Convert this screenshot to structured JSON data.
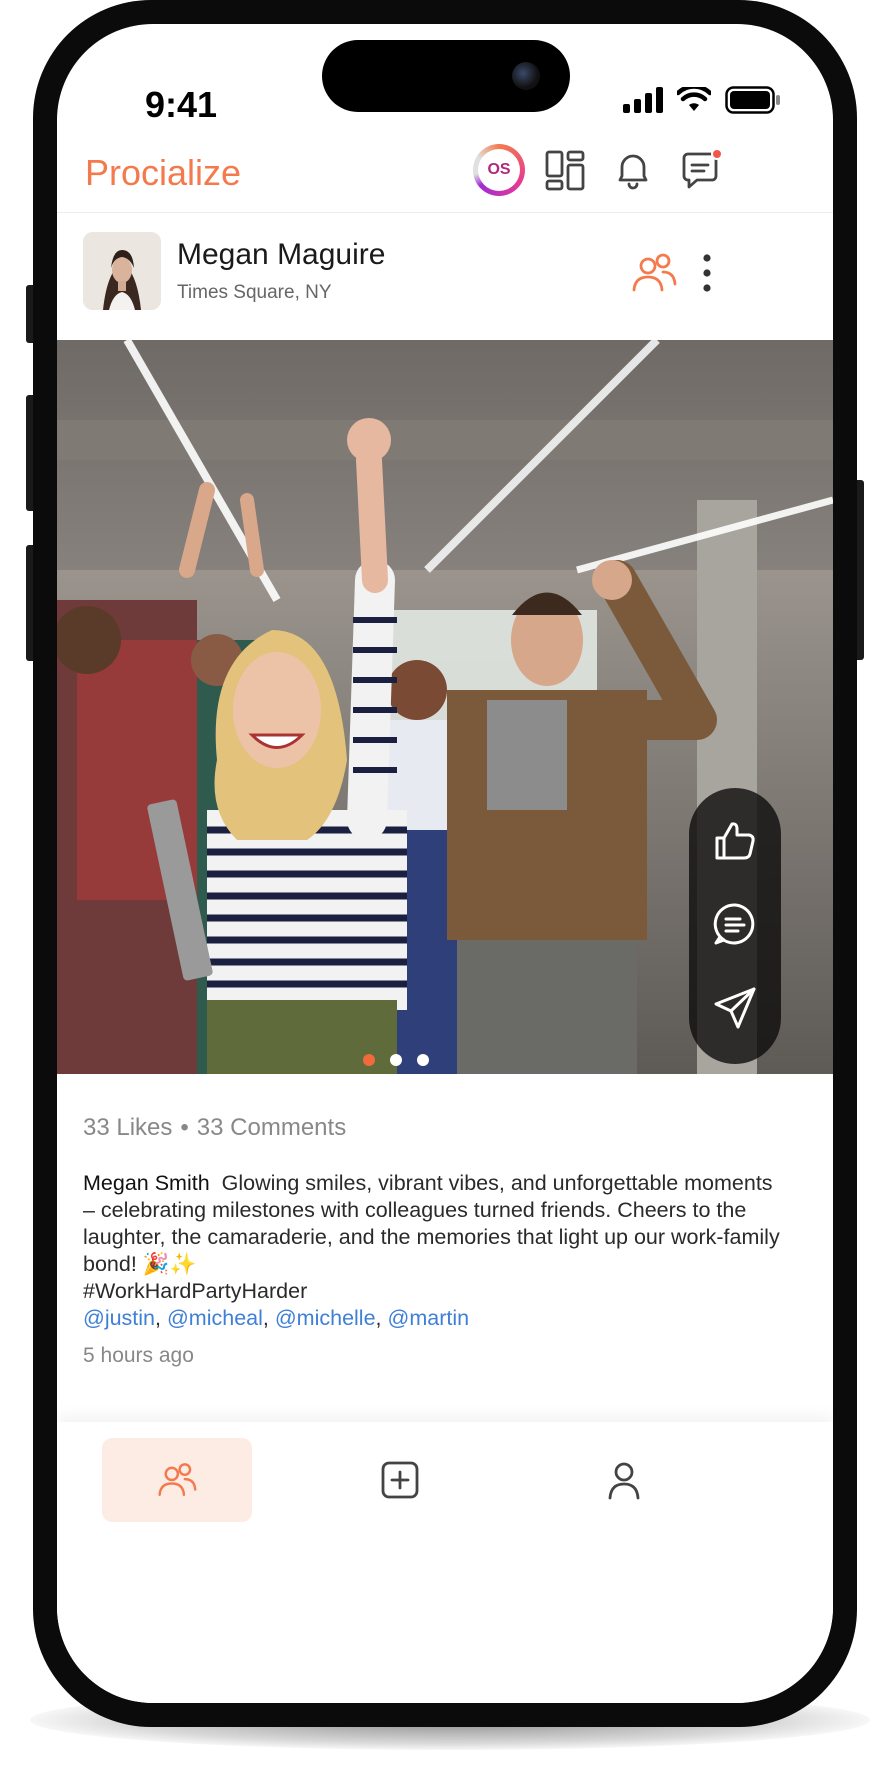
{
  "status_bar": {
    "time": "9:41"
  },
  "header": {
    "brand": "Procialize",
    "os_badge": "OS"
  },
  "post": {
    "author": "Megan Maguire",
    "location": "Times Square, NY",
    "likes": "33 Likes",
    "bullet": "•",
    "comments": "33 Comments",
    "caption_author": "Megan Smith",
    "caption_text": "Glowing smiles, vibrant vibes, and unforgettable moments – celebrating milestones with colleagues turned friends. Cheers to the laughter, the camaraderie, and the memories that light up our work-family bond! 🎉✨",
    "hashtag": "#WorkHardPartyHarder",
    "mentions": [
      "@justin",
      "@micheal",
      "@michelle",
      "@martin"
    ],
    "mention_separator": ", ",
    "timestamp": "5 hours ago",
    "carousel": {
      "total": 3,
      "active_index": 0
    }
  },
  "actions": {
    "like_icon": "thumbs-up-icon",
    "comment_icon": "comment-icon",
    "share_icon": "send-icon"
  },
  "bottom_nav": {
    "items": [
      {
        "icon": "people-icon",
        "active": true
      },
      {
        "icon": "add-post-icon",
        "active": false
      },
      {
        "icon": "profile-icon",
        "active": false
      }
    ]
  },
  "colors": {
    "accent": "#f47a4d",
    "link": "#3f7fd6",
    "active_nav_bg": "#fdece4"
  }
}
